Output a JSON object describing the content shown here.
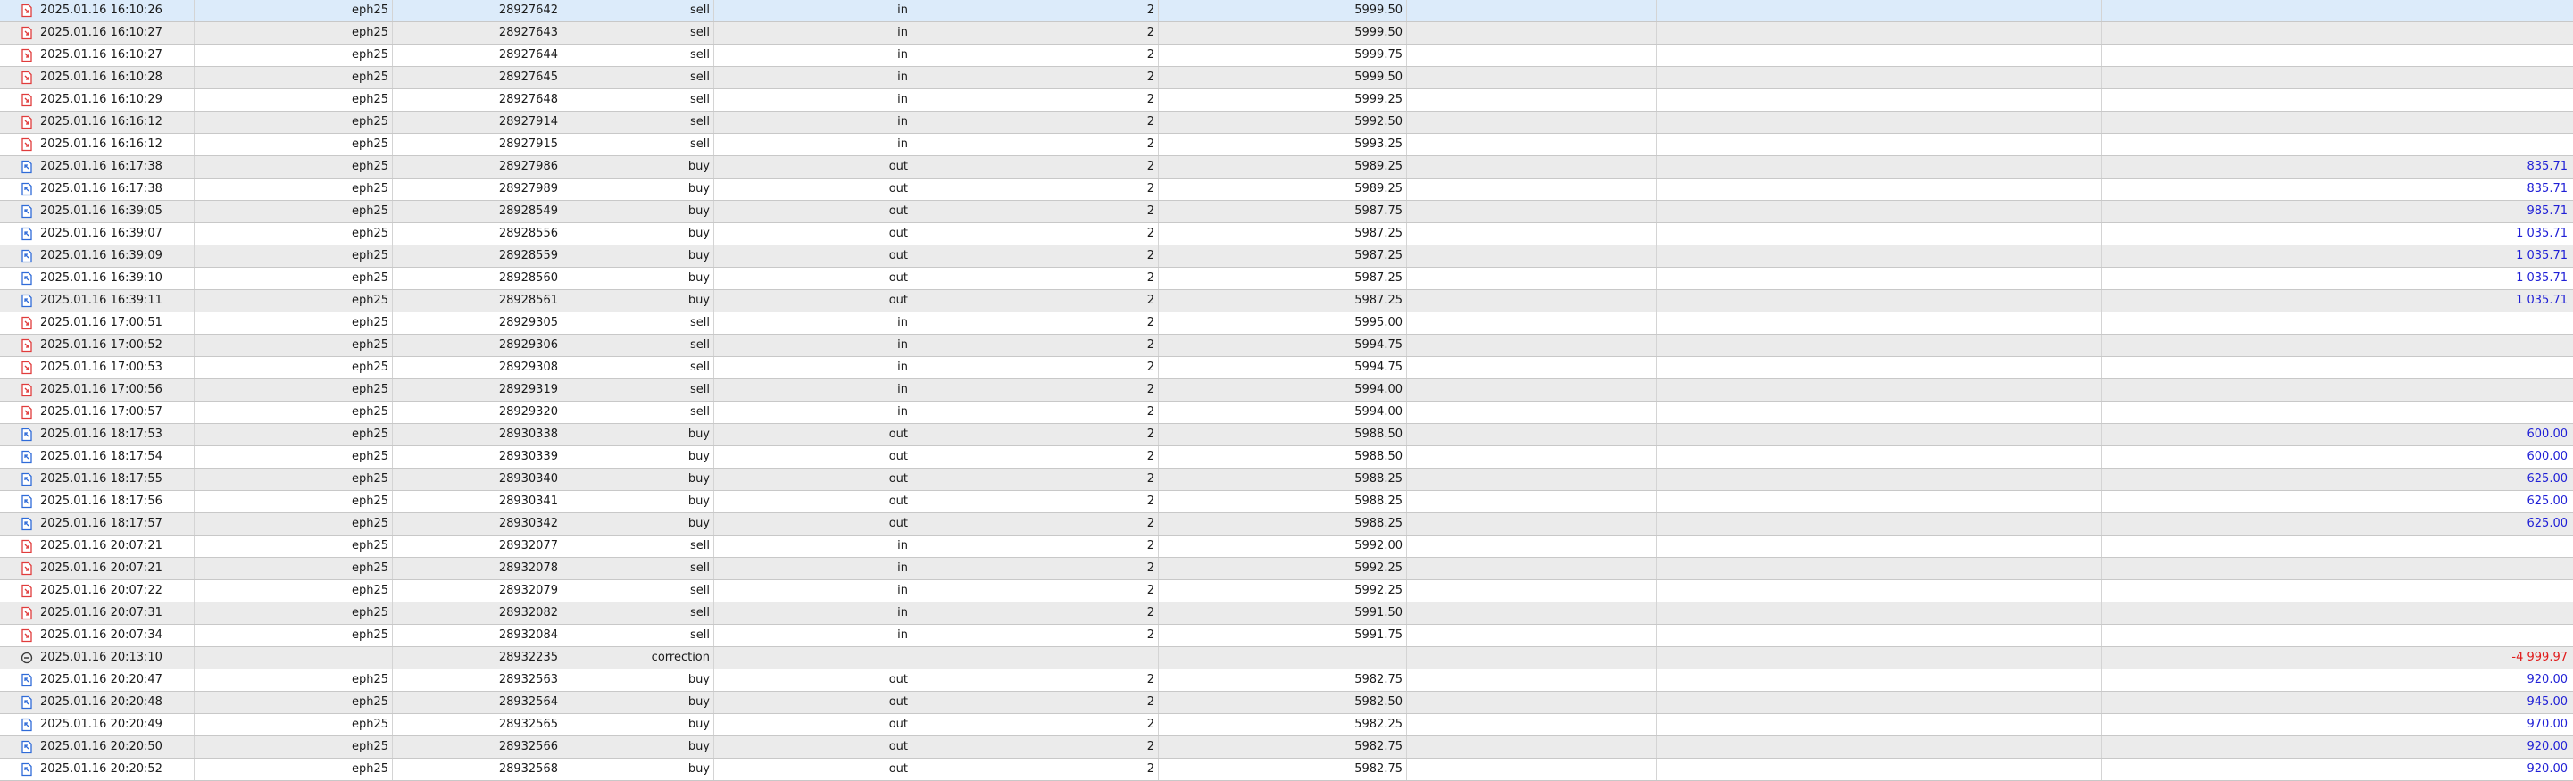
{
  "table": {
    "rows": [
      {
        "kind": "sell",
        "time": "2025.01.16 16:10:26",
        "symbol": "eph25",
        "deal": "28927642",
        "type": "sell",
        "direction": "in",
        "volume": "2",
        "price": "5999.50",
        "profit": ""
      },
      {
        "kind": "sell",
        "time": "2025.01.16 16:10:27",
        "symbol": "eph25",
        "deal": "28927643",
        "type": "sell",
        "direction": "in",
        "volume": "2",
        "price": "5999.50",
        "profit": ""
      },
      {
        "kind": "sell",
        "time": "2025.01.16 16:10:27",
        "symbol": "eph25",
        "deal": "28927644",
        "type": "sell",
        "direction": "in",
        "volume": "2",
        "price": "5999.75",
        "profit": ""
      },
      {
        "kind": "sell",
        "time": "2025.01.16 16:10:28",
        "symbol": "eph25",
        "deal": "28927645",
        "type": "sell",
        "direction": "in",
        "volume": "2",
        "price": "5999.50",
        "profit": ""
      },
      {
        "kind": "sell",
        "time": "2025.01.16 16:10:29",
        "symbol": "eph25",
        "deal": "28927648",
        "type": "sell",
        "direction": "in",
        "volume": "2",
        "price": "5999.25",
        "profit": ""
      },
      {
        "kind": "sell",
        "time": "2025.01.16 16:16:12",
        "symbol": "eph25",
        "deal": "28927914",
        "type": "sell",
        "direction": "in",
        "volume": "2",
        "price": "5992.50",
        "profit": ""
      },
      {
        "kind": "sell",
        "time": "2025.01.16 16:16:12",
        "symbol": "eph25",
        "deal": "28927915",
        "type": "sell",
        "direction": "in",
        "volume": "2",
        "price": "5993.25",
        "profit": ""
      },
      {
        "kind": "buy",
        "time": "2025.01.16 16:17:38",
        "symbol": "eph25",
        "deal": "28927986",
        "type": "buy",
        "direction": "out",
        "volume": "2",
        "price": "5989.25",
        "profit": "835.71"
      },
      {
        "kind": "buy",
        "time": "2025.01.16 16:17:38",
        "symbol": "eph25",
        "deal": "28927989",
        "type": "buy",
        "direction": "out",
        "volume": "2",
        "price": "5989.25",
        "profit": "835.71"
      },
      {
        "kind": "buy",
        "time": "2025.01.16 16:39:05",
        "symbol": "eph25",
        "deal": "28928549",
        "type": "buy",
        "direction": "out",
        "volume": "2",
        "price": "5987.75",
        "profit": "985.71"
      },
      {
        "kind": "buy",
        "time": "2025.01.16 16:39:07",
        "symbol": "eph25",
        "deal": "28928556",
        "type": "buy",
        "direction": "out",
        "volume": "2",
        "price": "5987.25",
        "profit": "1 035.71"
      },
      {
        "kind": "buy",
        "time": "2025.01.16 16:39:09",
        "symbol": "eph25",
        "deal": "28928559",
        "type": "buy",
        "direction": "out",
        "volume": "2",
        "price": "5987.25",
        "profit": "1 035.71"
      },
      {
        "kind": "buy",
        "time": "2025.01.16 16:39:10",
        "symbol": "eph25",
        "deal": "28928560",
        "type": "buy",
        "direction": "out",
        "volume": "2",
        "price": "5987.25",
        "profit": "1 035.71"
      },
      {
        "kind": "buy",
        "time": "2025.01.16 16:39:11",
        "symbol": "eph25",
        "deal": "28928561",
        "type": "buy",
        "direction": "out",
        "volume": "2",
        "price": "5987.25",
        "profit": "1 035.71"
      },
      {
        "kind": "sell",
        "time": "2025.01.16 17:00:51",
        "symbol": "eph25",
        "deal": "28929305",
        "type": "sell",
        "direction": "in",
        "volume": "2",
        "price": "5995.00",
        "profit": ""
      },
      {
        "kind": "sell",
        "time": "2025.01.16 17:00:52",
        "symbol": "eph25",
        "deal": "28929306",
        "type": "sell",
        "direction": "in",
        "volume": "2",
        "price": "5994.75",
        "profit": ""
      },
      {
        "kind": "sell",
        "time": "2025.01.16 17:00:53",
        "symbol": "eph25",
        "deal": "28929308",
        "type": "sell",
        "direction": "in",
        "volume": "2",
        "price": "5994.75",
        "profit": ""
      },
      {
        "kind": "sell",
        "time": "2025.01.16 17:00:56",
        "symbol": "eph25",
        "deal": "28929319",
        "type": "sell",
        "direction": "in",
        "volume": "2",
        "price": "5994.00",
        "profit": ""
      },
      {
        "kind": "sell",
        "time": "2025.01.16 17:00:57",
        "symbol": "eph25",
        "deal": "28929320",
        "type": "sell",
        "direction": "in",
        "volume": "2",
        "price": "5994.00",
        "profit": ""
      },
      {
        "kind": "buy",
        "time": "2025.01.16 18:17:53",
        "symbol": "eph25",
        "deal": "28930338",
        "type": "buy",
        "direction": "out",
        "volume": "2",
        "price": "5988.50",
        "profit": "600.00"
      },
      {
        "kind": "buy",
        "time": "2025.01.16 18:17:54",
        "symbol": "eph25",
        "deal": "28930339",
        "type": "buy",
        "direction": "out",
        "volume": "2",
        "price": "5988.50",
        "profit": "600.00"
      },
      {
        "kind": "buy",
        "time": "2025.01.16 18:17:55",
        "symbol": "eph25",
        "deal": "28930340",
        "type": "buy",
        "direction": "out",
        "volume": "2",
        "price": "5988.25",
        "profit": "625.00"
      },
      {
        "kind": "buy",
        "time": "2025.01.16 18:17:56",
        "symbol": "eph25",
        "deal": "28930341",
        "type": "buy",
        "direction": "out",
        "volume": "2",
        "price": "5988.25",
        "profit": "625.00"
      },
      {
        "kind": "buy",
        "time": "2025.01.16 18:17:57",
        "symbol": "eph25",
        "deal": "28930342",
        "type": "buy",
        "direction": "out",
        "volume": "2",
        "price": "5988.25",
        "profit": "625.00"
      },
      {
        "kind": "sell",
        "time": "2025.01.16 20:07:21",
        "symbol": "eph25",
        "deal": "28932077",
        "type": "sell",
        "direction": "in",
        "volume": "2",
        "price": "5992.00",
        "profit": ""
      },
      {
        "kind": "sell",
        "time": "2025.01.16 20:07:21",
        "symbol": "eph25",
        "deal": "28932078",
        "type": "sell",
        "direction": "in",
        "volume": "2",
        "price": "5992.25",
        "profit": ""
      },
      {
        "kind": "sell",
        "time": "2025.01.16 20:07:22",
        "symbol": "eph25",
        "deal": "28932079",
        "type": "sell",
        "direction": "in",
        "volume": "2",
        "price": "5992.25",
        "profit": ""
      },
      {
        "kind": "sell",
        "time": "2025.01.16 20:07:31",
        "symbol": "eph25",
        "deal": "28932082",
        "type": "sell",
        "direction": "in",
        "volume": "2",
        "price": "5991.50",
        "profit": ""
      },
      {
        "kind": "sell",
        "time": "2025.01.16 20:07:34",
        "symbol": "eph25",
        "deal": "28932084",
        "type": "sell",
        "direction": "in",
        "volume": "2",
        "price": "5991.75",
        "profit": ""
      },
      {
        "kind": "correction",
        "time": "2025.01.16 20:13:10",
        "symbol": "",
        "deal": "28932235",
        "type": "correction",
        "direction": "",
        "volume": "",
        "price": "",
        "profit": "-4 999.97"
      },
      {
        "kind": "buy",
        "time": "2025.01.16 20:20:47",
        "symbol": "eph25",
        "deal": "28932563",
        "type": "buy",
        "direction": "out",
        "volume": "2",
        "price": "5982.75",
        "profit": "920.00"
      },
      {
        "kind": "buy",
        "time": "2025.01.16 20:20:48",
        "symbol": "eph25",
        "deal": "28932564",
        "type": "buy",
        "direction": "out",
        "volume": "2",
        "price": "5982.50",
        "profit": "945.00"
      },
      {
        "kind": "buy",
        "time": "2025.01.16 20:20:49",
        "symbol": "eph25",
        "deal": "28932565",
        "type": "buy",
        "direction": "out",
        "volume": "2",
        "price": "5982.25",
        "profit": "970.00"
      },
      {
        "kind": "buy",
        "time": "2025.01.16 20:20:50",
        "symbol": "eph25",
        "deal": "28932566",
        "type": "buy",
        "direction": "out",
        "volume": "2",
        "price": "5982.75",
        "profit": "920.00"
      },
      {
        "kind": "buy",
        "time": "2025.01.16 20:20:52",
        "symbol": "eph25",
        "deal": "28932568",
        "type": "buy",
        "direction": "out",
        "volume": "2",
        "price": "5982.75",
        "profit": "920.00"
      }
    ],
    "icons": {
      "sell": "sell-deal-icon",
      "buy": "buy-deal-icon",
      "correction": "correction-icon"
    },
    "colors": {
      "sell_icon": "#e03c3c",
      "buy_icon": "#2f6bd8",
      "correction_icon": "#3a3a3a",
      "profit_positive": "#1f1fd6",
      "profit_negative": "#e01a1a",
      "row_alt": "#ebebeb",
      "row_selected": "#dcebfa"
    }
  }
}
